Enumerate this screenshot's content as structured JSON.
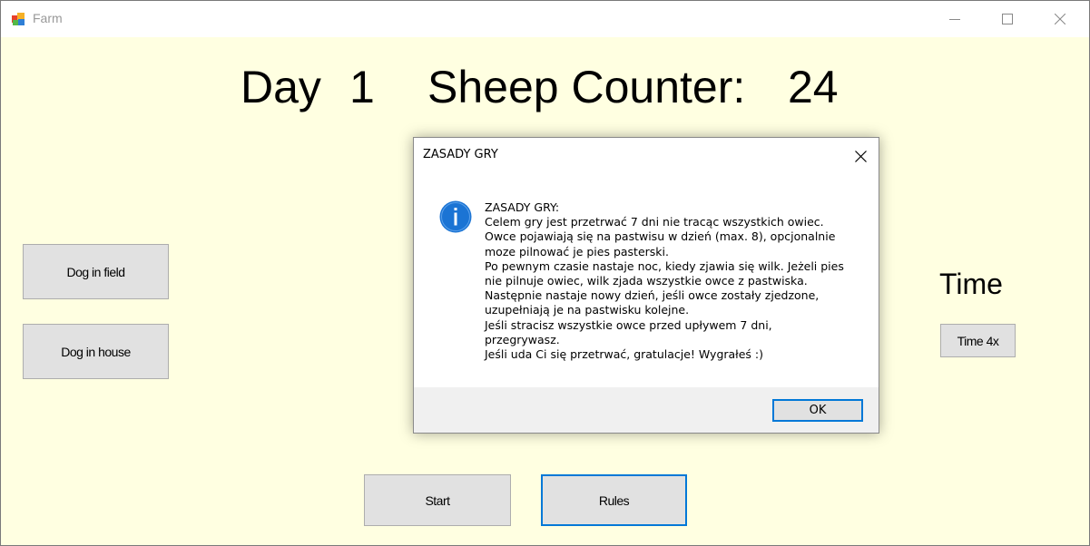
{
  "window": {
    "title": "Farm",
    "controls": {
      "minimize_icon": "minimize-icon",
      "maximize_icon": "maximize-icon",
      "close_icon": "close-icon"
    }
  },
  "header": {
    "day_label": "Day",
    "day_value": "1",
    "sheep_label": "Sheep Counter:",
    "sheep_value": "24"
  },
  "left_panel": {
    "dog_in_field_label": "Dog in field",
    "dog_in_house_label": "Dog in house"
  },
  "right_panel": {
    "time_label": "Time",
    "time4x_label": "Time 4x"
  },
  "bottom": {
    "start_label": "Start",
    "rules_label": "Rules"
  },
  "dialog": {
    "title": "ZASADY GRY",
    "icon": "info-icon",
    "message_lines": [
      "ZASADY GRY:",
      "Celem gry jest przetrwać 7 dni nie tracąc wszystkich owiec.",
      "Owce pojawiają się na pastwisu w dzień (max. 8), opcjonalnie",
      "moze pilnować je pies pasterski.",
      "Po pewnym czasie nastaje noc, kiedy zjawia się wilk. Jeżeli pies",
      "nie pilnuje owiec, wilk zjada wszystkie owce z pastwiska.",
      "Następnie nastaje nowy dzień,  jeśli owce zostały zjedzone,",
      "uzupełniają je na pastwisku kolejne.",
      "Jeśli stracisz wszystkie owce przed upływem 7 dni,",
      "przegrywasz.",
      "Jeśli uda Ci się przetrwać, gratulacje! Wygrałeś :)"
    ],
    "ok_label": "OK"
  },
  "colors": {
    "form_background": "#ffffe1",
    "button_face": "#e1e1e1",
    "focus_accent": "#0078d7",
    "info_icon": "#1b74d4"
  }
}
